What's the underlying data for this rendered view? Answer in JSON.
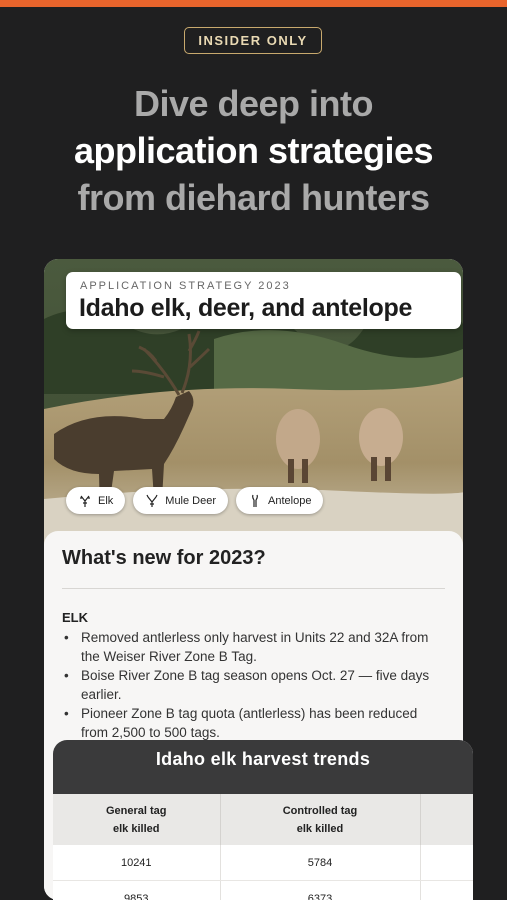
{
  "badge": "INSIDER ONLY",
  "headline": {
    "line1": "Dive deep into",
    "line2": "application strategies",
    "line3": "from diehard hunters"
  },
  "card": {
    "subtitle": "APPLICATION STRATEGY 2023",
    "title": "Idaho elk, deer, and antelope",
    "chips": [
      {
        "label": "Elk",
        "icon": "elk-icon"
      },
      {
        "label": "Mule Deer",
        "icon": "deer-icon"
      },
      {
        "label": "Antelope",
        "icon": "antelope-icon"
      }
    ],
    "news": {
      "heading": "What's new for 2023?",
      "section": "ELK",
      "bullets": [
        "Removed antlerless only harvest in Units 22 and 32A from the Weiser River Zone B Tag.",
        "Boise River Zone B tag season opens Oct. 27 — five days earlier.",
        "Pioneer Zone B tag quota (antlerless) has been reduced from 2,500 to 500 tags."
      ]
    }
  },
  "trends": {
    "title": "Idaho elk harvest trends",
    "headers": [
      [
        "General tag",
        "elk killed"
      ],
      [
        "Controlled tag",
        "elk killed"
      ],
      [
        "",
        ""
      ]
    ],
    "rows": [
      [
        "10241",
        "5784",
        ""
      ],
      [
        "9853",
        "6373",
        ""
      ]
    ]
  },
  "colors": {
    "accent": "#e8642c",
    "badge_border": "#c8a96e",
    "background": "#1f1f20"
  }
}
